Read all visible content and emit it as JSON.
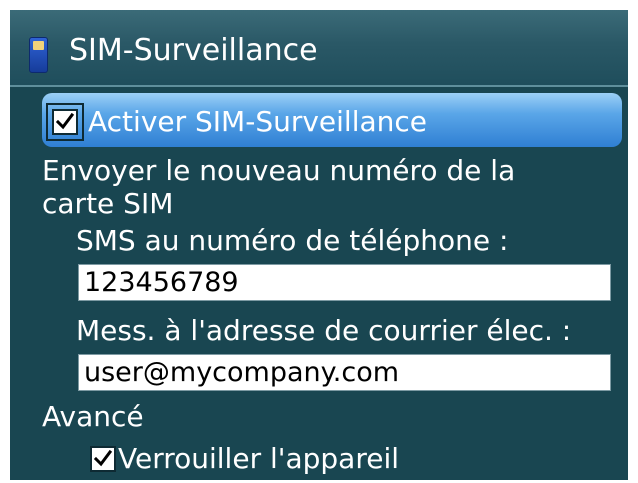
{
  "app": {
    "title": "SIM-Surveillance",
    "icon": "sim-card-icon"
  },
  "colors": {
    "background": "#194651",
    "focus_highlight": "#4a9be2",
    "text": "#ffffff",
    "field_background": "#ffffff"
  },
  "enable": {
    "label": "Activer SIM-Surveillance",
    "checked": true
  },
  "send_section": {
    "heading_line1": "Envoyer le nouveau numéro de la",
    "heading_line2": "carte SIM"
  },
  "sms": {
    "label": "SMS au numéro de téléphone :",
    "value": "123456789"
  },
  "email": {
    "label": "Mess. à l'adresse de courrier élec. :",
    "value": "user@mycompany.com"
  },
  "advanced": {
    "heading": "Avancé",
    "lock_label": "Verrouiller l'appareil",
    "lock_checked": true
  }
}
